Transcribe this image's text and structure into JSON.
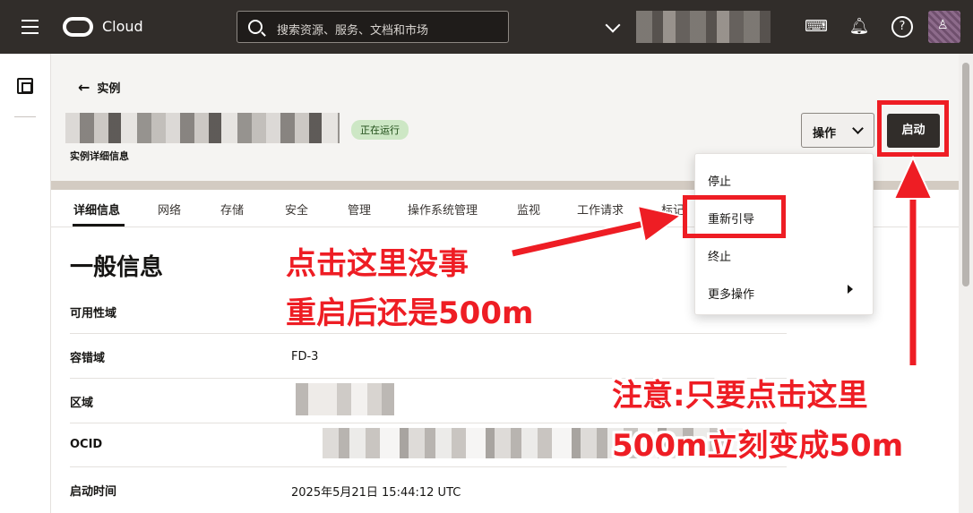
{
  "topbar": {
    "logo_text": "Cloud",
    "search_placeholder": "搜索资源、服务、文档和市场"
  },
  "header": {
    "back_label": "实例",
    "status_badge": "正在运行",
    "subtitle": "实例详细信息",
    "actions_label": "操作",
    "start_label": "启动"
  },
  "tabs": [
    "详细信息",
    "网络",
    "存储",
    "安全",
    "管理",
    "操作系统管理",
    "监视",
    "工作请求",
    "标记"
  ],
  "general": {
    "title": "一般信息",
    "rows": [
      {
        "label": "可用性域",
        "value": ""
      },
      {
        "label": "容错域",
        "value": "FD-3"
      },
      {
        "label": "区域",
        "value": ""
      },
      {
        "label": "OCID",
        "value": ""
      },
      {
        "label": "启动时间",
        "value": "2025年5月21日 15:44:12 UTC"
      }
    ]
  },
  "menu": {
    "items": [
      "停止",
      "重新引导",
      "终止",
      "更多操作"
    ]
  },
  "annotations": {
    "left_line1": "点击这里没事",
    "left_line2": "重启后还是500m",
    "right_line1": "注意:只要点击这里",
    "right_line2": "500m立刻变成50m"
  },
  "colors": {
    "topbar": "#312d2a",
    "annotation_red": "#ee1d24",
    "status_green": "#cde7c5"
  }
}
